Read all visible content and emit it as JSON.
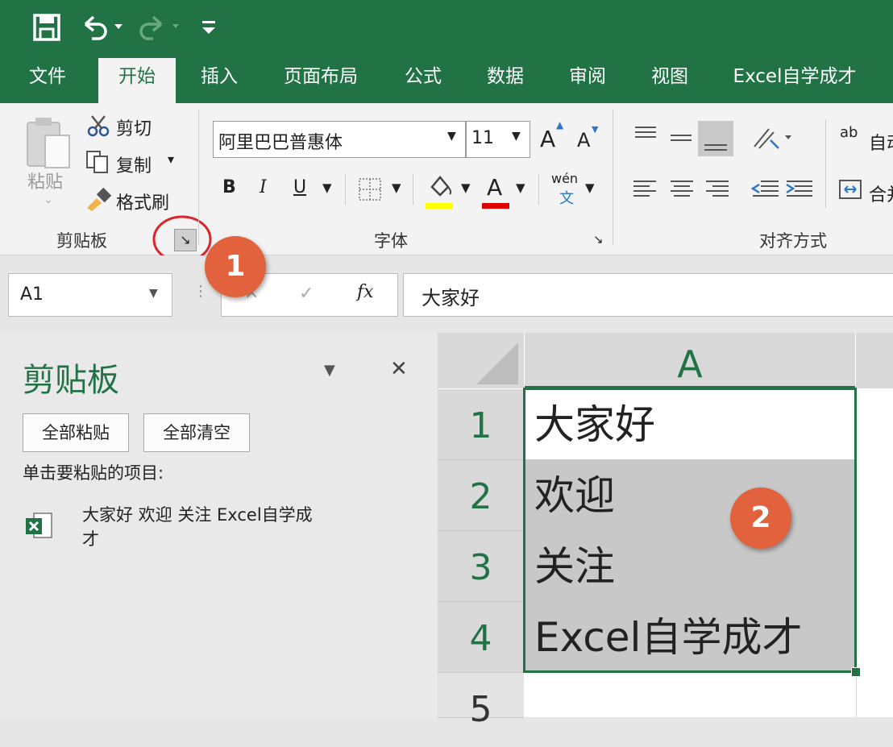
{
  "ribbon_tabs": [
    "文件",
    "开始",
    "插入",
    "页面布局",
    "公式",
    "数据",
    "审阅",
    "视图",
    "Excel自学成才"
  ],
  "clipboard_group": {
    "paste_label": "粘贴",
    "cut_label": "剪切",
    "copy_label": "复制",
    "format_painter_label": "格式刷",
    "title": "剪贴板"
  },
  "font_group": {
    "font_name": "阿里巴巴普惠体",
    "font_size": "11",
    "grow_label": "A",
    "shrink_label": "A",
    "bold_label": "B",
    "italic_label": "I",
    "underline_label": "U",
    "font_color_label": "A",
    "phonetic_label": "wén",
    "phonetic_sub": "文",
    "title": "字体",
    "highlight_color": "#ffff00",
    "font_color": "#e00000"
  },
  "align_group": {
    "wrap_label": "自动",
    "merge_label": "合并",
    "title": "对齐方式",
    "wrap_icon_text": "ab"
  },
  "formula_bar": {
    "name_box": "A1",
    "fx_label": "fx",
    "content": "大家好"
  },
  "clipboard_pane": {
    "title": "剪贴板",
    "paste_all": "全部粘贴",
    "clear_all": "全部清空",
    "instruction": "单击要粘贴的项目:",
    "item_text_line1": "大家好 欢迎 关注 Excel自学成",
    "item_text_line2": "才"
  },
  "sheet": {
    "column_header": "A",
    "rows": [
      {
        "num": "1",
        "value": "大家好"
      },
      {
        "num": "2",
        "value": "欢迎"
      },
      {
        "num": "3",
        "value": "关注"
      },
      {
        "num": "4",
        "value": "Excel自学成才"
      },
      {
        "num": "5",
        "value": ""
      }
    ]
  },
  "badges": [
    "1",
    "2"
  ],
  "colors": {
    "excel_green": "#217346",
    "badge_color": "#e1623c",
    "selection_fill": "#c8c8c8"
  }
}
